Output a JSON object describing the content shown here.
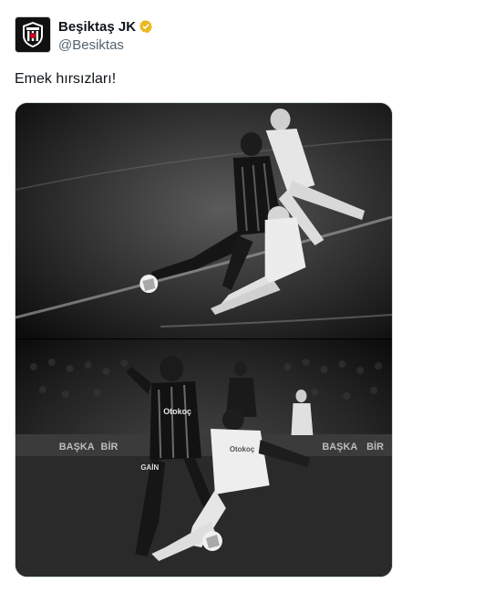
{
  "account": {
    "display_name": "Beşiktaş JK",
    "handle": "@Besiktas",
    "verified": true,
    "verified_color": "#e8b923",
    "avatar_icon": "besiktas-crest-icon"
  },
  "tweet": {
    "text": "Emek hırsızları!"
  },
  "media": {
    "photos": [
      {
        "description_icon": "football-tackle-photo-top"
      },
      {
        "description_icon": "football-tackle-photo-bottom"
      }
    ],
    "board_text_1": "BAŞKA",
    "board_text_2": "BİR",
    "board_text_3": "BAŞKA",
    "board_text_4": "BİR",
    "jersey_sponsor": "Otokoç",
    "jersey_sponsor_2": "Otokoç",
    "shorts_sponsor": "GAİN"
  },
  "colors": {
    "text_primary": "#0f1419",
    "text_secondary": "#536471",
    "border": "#cfd9de"
  }
}
